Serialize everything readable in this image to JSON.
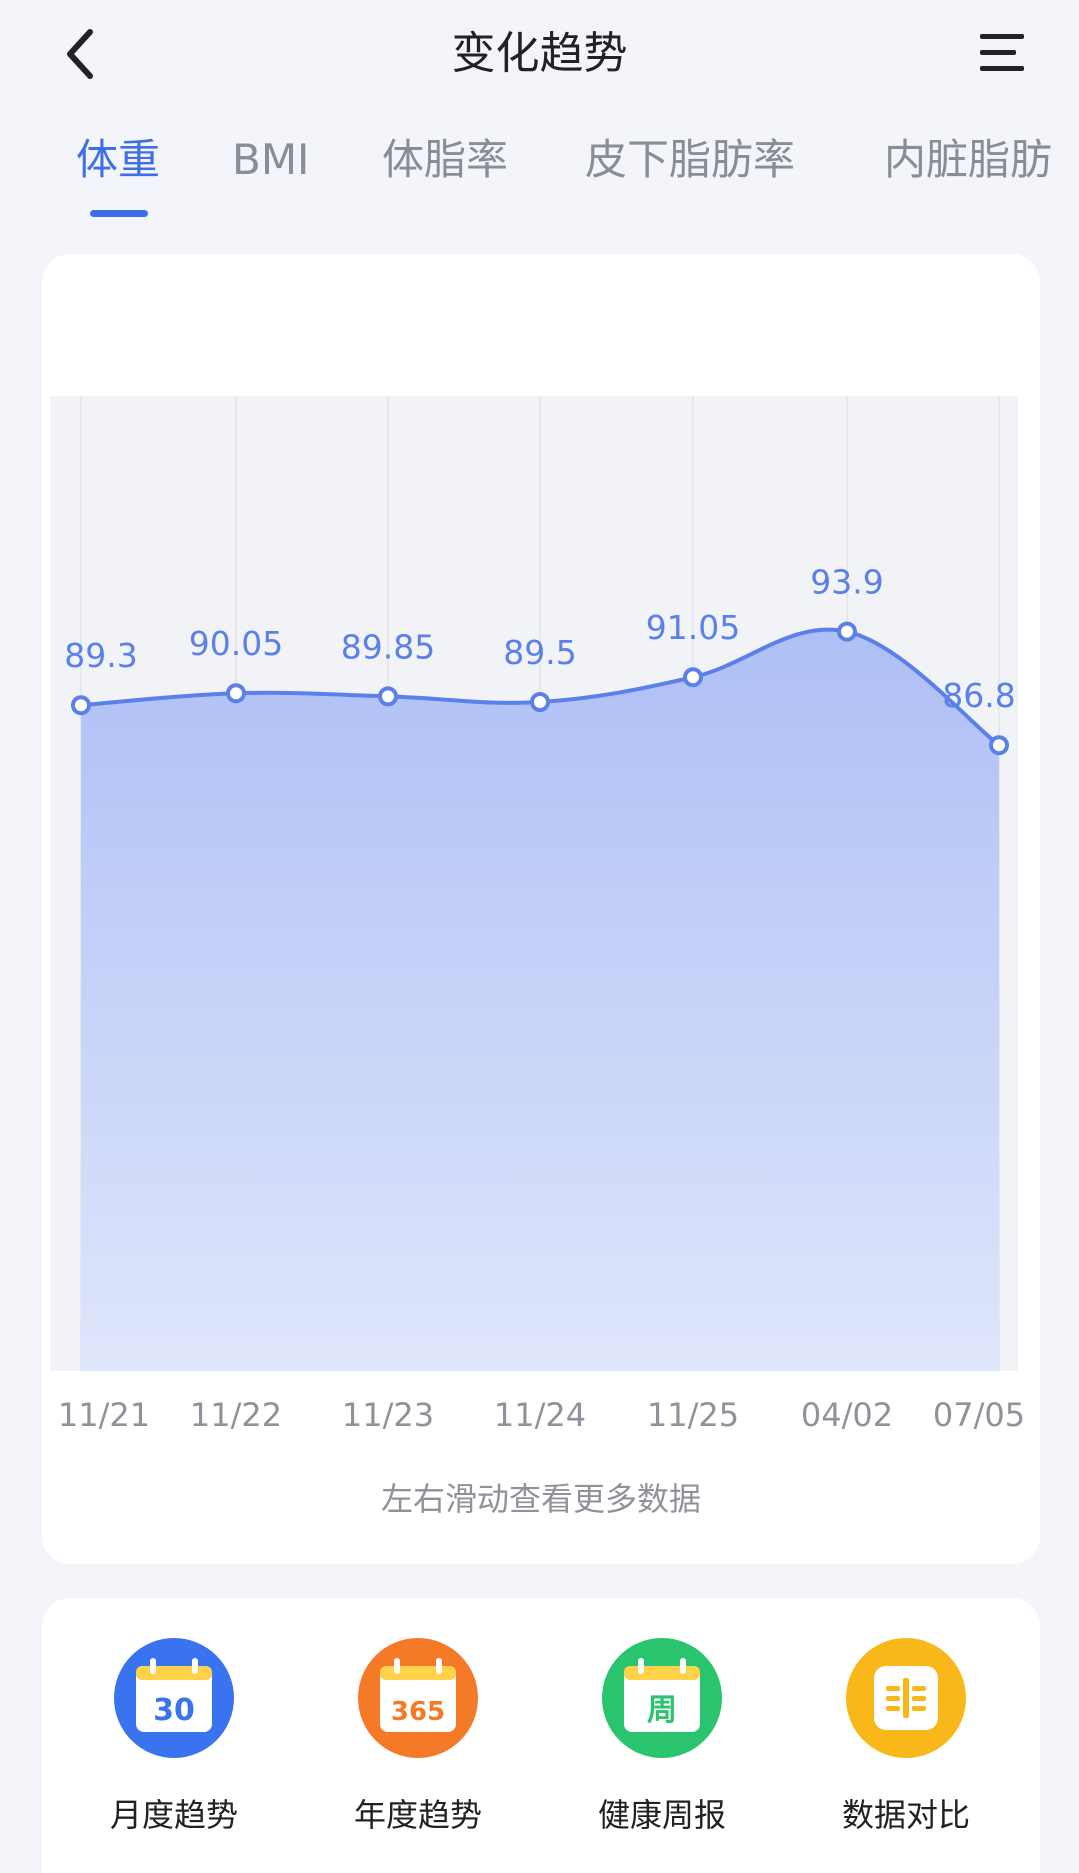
{
  "header": {
    "title": "变化趋势"
  },
  "tabs": [
    {
      "label": "体重",
      "active": true
    },
    {
      "label": "BMI",
      "active": false
    },
    {
      "label": "体脂率",
      "active": false
    },
    {
      "label": "皮下脂肪率",
      "active": false
    },
    {
      "label": "内脏脂肪",
      "active": false
    }
  ],
  "chart_data": {
    "type": "area",
    "x": [
      "11/21",
      "11/22",
      "11/23",
      "11/24",
      "11/25",
      "04/02",
      "07/05"
    ],
    "values": [
      89.3,
      90.05,
      89.85,
      89.5,
      91.05,
      93.9,
      86.8
    ],
    "title": "",
    "xlabel": "",
    "ylabel": "",
    "grid": true,
    "colors": {
      "line": "#5b80ea",
      "fill_top": "#aebff5",
      "fill_bottom": "#dfe6fb"
    }
  },
  "chart_hint": "左右滑动查看更多数据",
  "actions": [
    {
      "label": "月度趋势",
      "icon": "calendar-30-icon",
      "badge": "30",
      "color": "#3a73f0"
    },
    {
      "label": "年度趋势",
      "icon": "calendar-365-icon",
      "badge": "365",
      "color": "#f47a27"
    },
    {
      "label": "健康周报",
      "icon": "calendar-week-icon",
      "badge": "周",
      "color": "#2bc46e"
    },
    {
      "label": "数据对比",
      "icon": "compare-icon",
      "badge": "",
      "color": "#f8b81a"
    }
  ]
}
